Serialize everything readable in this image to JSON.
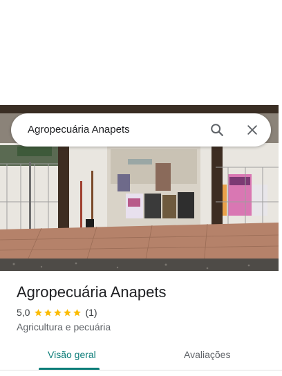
{
  "search": {
    "query": "Agropecuária Anapets"
  },
  "place": {
    "name": "Agropecuária Anapets",
    "rating": "5,0",
    "review_count": "(1)",
    "stars": 5,
    "category": "Agricultura e pecuária"
  },
  "tabs": [
    {
      "label": "Visão geral",
      "active": true
    },
    {
      "label": "Avaliações",
      "active": false
    }
  ],
  "colors": {
    "accent": "#0b7c78",
    "star": "#fbbc04"
  },
  "icons": [
    "search-icon",
    "close-icon",
    "star-icon"
  ]
}
